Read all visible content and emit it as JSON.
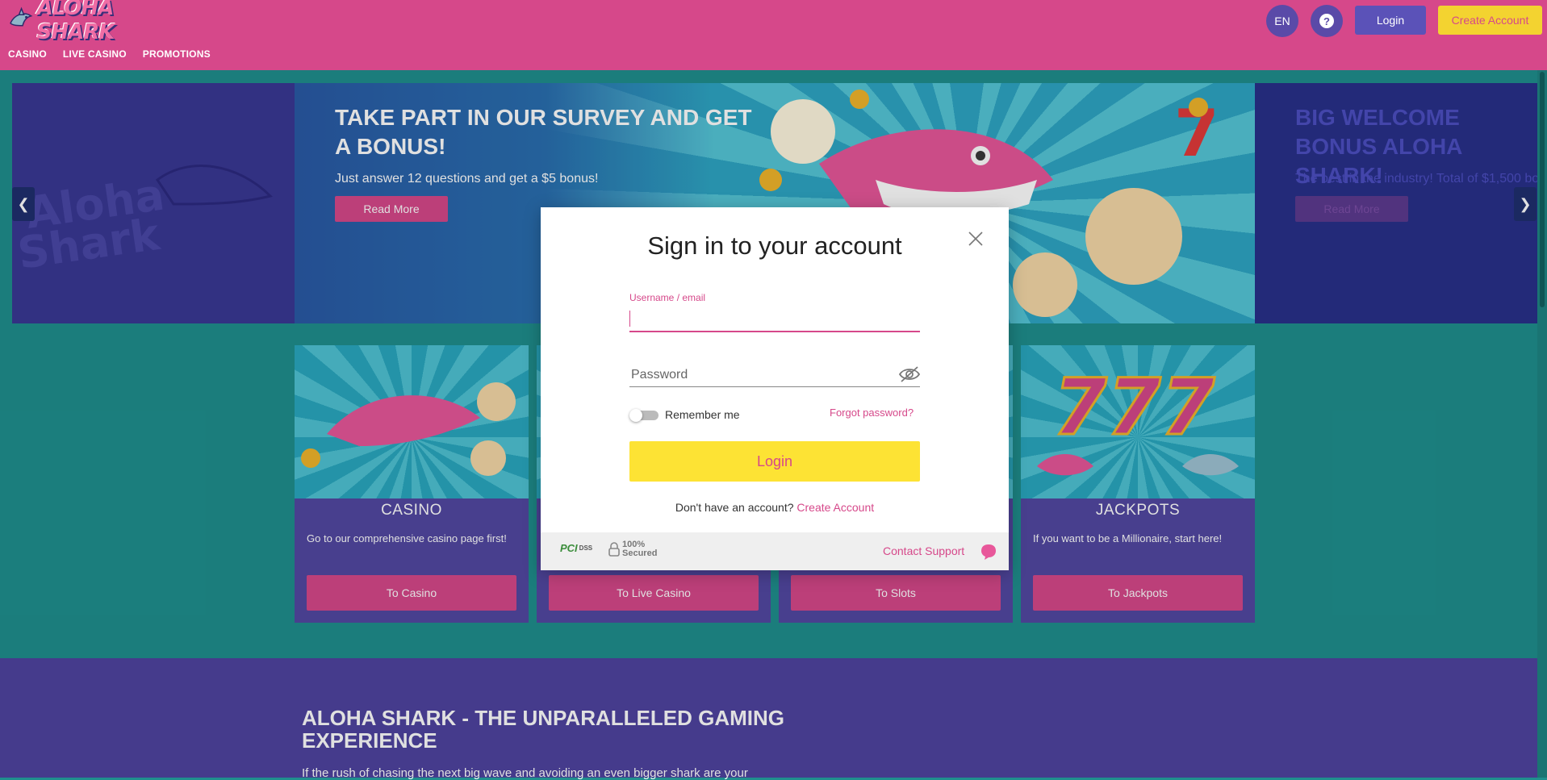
{
  "header": {
    "logo_text": "ALOHA SHARK",
    "nav": [
      "CASINO",
      "LIVE CASINO",
      "PROMOTIONS"
    ],
    "language": "EN",
    "help_icon": "question-icon",
    "login_label": "Login",
    "create_account_label": "Create Account"
  },
  "slider": {
    "slides": [
      {
        "title": "TAKE PART IN OUR SURVEY AND GET A BONUS!",
        "subtitle": "Just answer 12 questions and get a $5 bonus!",
        "button": "Read More"
      },
      {
        "title": "BIG WELCOME BONUS ALOHA SHARK!",
        "subtitle": "The best in the industry! Total of $1,500 bo",
        "button": "Read More"
      }
    ],
    "prev_icon": "chevron-left-icon",
    "next_icon": "chevron-right-icon"
  },
  "cards": [
    {
      "title": "CASINO",
      "desc": "Go to our comprehensive casino page first!",
      "button": "To Casino"
    },
    {
      "title": "",
      "desc": "",
      "button": "To Live Casino"
    },
    {
      "title": "",
      "desc": "",
      "button": "To Slots"
    },
    {
      "title": "JACKPOTS",
      "desc": "If you want to be a Millionaire, start here!",
      "button": "To Jackpots"
    }
  ],
  "about": {
    "title": "ALOHA SHARK - THE UNPARALLELED GAMING EXPERIENCE",
    "text": "If the rush of chasing the next big wave and avoiding an even bigger shark are your"
  },
  "modal": {
    "title": "Sign in to your account",
    "username_label": "Username / email",
    "username_value": "",
    "password_placeholder": "Password",
    "remember_label": "Remember me",
    "forgot_label": "Forgot password?",
    "login_button": "Login",
    "no_account_text": "Don't have an account?",
    "create_account_link": "Create Account",
    "footer": {
      "pci_label": "PCI",
      "dss_label": "DSS",
      "secured_percent": "100%",
      "secured_label": "Secured",
      "contact_support": "Contact Support"
    }
  },
  "colors": {
    "brand_pink": "#d6488a",
    "brand_yellow": "#fde334",
    "brand_purple": "#5248a2",
    "teal_bg": "#1f8f8e"
  }
}
